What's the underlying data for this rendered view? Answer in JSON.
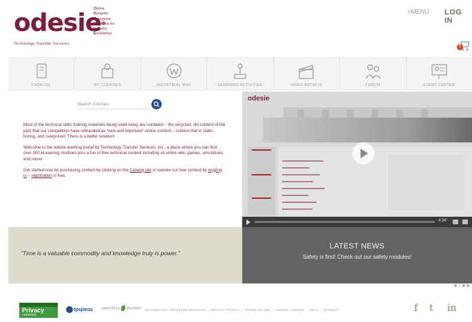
{
  "header": {
    "logo": {
      "word": "odesie",
      "reg": "®",
      "tagline": "Technology Transfer Services"
    },
    "acronym": [
      {
        "letter": "O",
        "rest": "nline"
      },
      {
        "letter": "D",
        "rest": "ynamic"
      },
      {
        "letter": "E",
        "rest": "nterprise"
      },
      {
        "letter": "S",
        "rest": "olutions for"
      },
      {
        "letter": "I",
        "rest": "ndustry"
      },
      {
        "letter": "E",
        "rest": "xcellence"
      }
    ],
    "menu_label": "MENU",
    "login_label": "LOG IN",
    "cart_count": "0"
  },
  "nav": [
    {
      "label": "CATALOG",
      "icon": "catalog-icon"
    },
    {
      "label": "MY COURSES",
      "icon": "courses-icon"
    },
    {
      "label": "INDUSTRIAL WIKI",
      "icon": "wiki-icon"
    },
    {
      "label": "LEARNING ACTIVITIES",
      "icon": "joystick-icon"
    },
    {
      "label": "VIDEO ARCHIVE",
      "icon": "clapper-icon"
    },
    {
      "label": "FORUM",
      "icon": "forum-icon"
    },
    {
      "label": "EVENT CENTER",
      "icon": "presenter-icon"
    }
  ],
  "search": {
    "placeholder": "Search Courses"
  },
  "intro": {
    "p1": "Most of the technical skills training materials being used today are outdated- - the recycled, old content of the past that our competition have rebranded as “new and improved” online content – content that is static, boring, and overpriced. There is a better solution!",
    "p2": "Welcome to the odesie learning portal by Technology Transfer Services, Inc., a place where you can find over 300 eLearning modules plus a ton of free technical content including an entire wiki, games, simulations and more!",
    "p3_a": "Get started now by purchasing content by clicking on the ",
    "p3_link1": "Catalog tab",
    "p3_b": " or explore our free content by ",
    "p3_link2": "logging in",
    "p3_c": " – ",
    "p3_link3": "registration",
    "p3_d": " is free."
  },
  "video": {
    "logo_word": "odesie",
    "time": "4:36"
  },
  "quote": "“Time is a valuable commodity and knowledge truly is power.”",
  "news": {
    "title": "LATEST NEWS",
    "text": "Safety is first! Check out our safety modules!",
    "slides": 4,
    "active_slide": 1
  },
  "footer": {
    "privacy_badge": {
      "title": "Privacy",
      "subtitle": "VERIFIED"
    },
    "partner_logo": "tpsjimsc",
    "partner2_prefix": "powered by",
    "partner2_name": "tetonshire",
    "links": [
      "TECHNOLOGY TRANSFER SERVICES",
      "PRIVACY POLICY",
      "TERMS OF USE",
      "ODESIE LICENSE",
      "HELP",
      "SITEMAP"
    ],
    "social": [
      {
        "label": "f",
        "icon": "facebook-icon"
      },
      {
        "label": "t",
        "icon": "twitter-icon"
      },
      {
        "label": "in",
        "icon": "linkedin-icon"
      }
    ]
  },
  "colors": {
    "brand": "#7a1e3a",
    "news_bg": "#636363",
    "quote_bg": "#dedbce",
    "search_button": "#2a4a8c"
  }
}
